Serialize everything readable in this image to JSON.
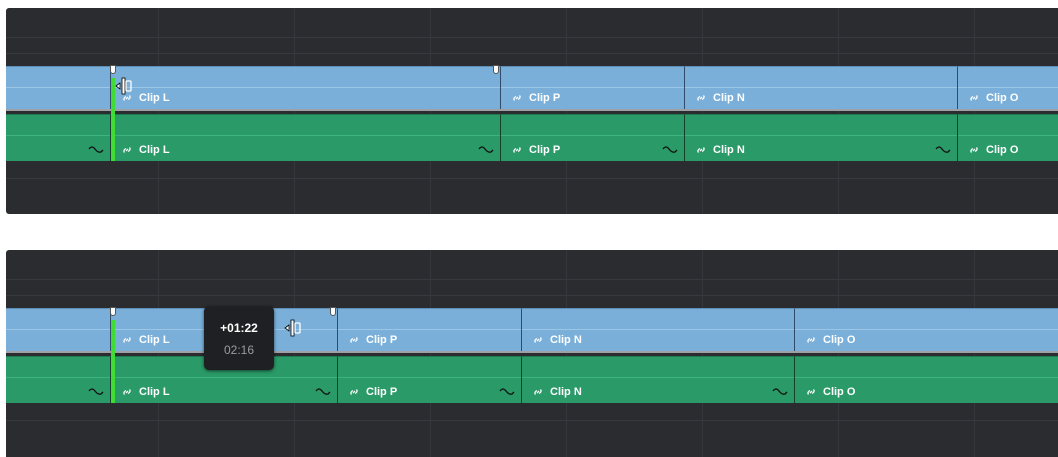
{
  "colors": {
    "panel_bg": "#2b2c30",
    "video_clip": "#79afd9",
    "audio_clip": "#2a9a68",
    "trim_edge": "#3fdd33"
  },
  "icons": [
    "link-icon",
    "waveform-icon",
    "trim-cursor-icon",
    "clip-handle"
  ],
  "top_timeline": {
    "video_clips": [
      {
        "label": ""
      },
      {
        "label": "Clip L"
      },
      {
        "label": "Clip P"
      },
      {
        "label": "Clip N"
      },
      {
        "label": "Clip O"
      }
    ],
    "audio_clips": [
      {
        "label": ""
      },
      {
        "label": "Clip L"
      },
      {
        "label": "Clip P"
      },
      {
        "label": "Clip N"
      },
      {
        "label": "Clip O"
      }
    ]
  },
  "bottom_timeline": {
    "video_clips": [
      {
        "label": ""
      },
      {
        "label": "Clip L"
      },
      {
        "label": "Clip P"
      },
      {
        "label": "Clip N"
      },
      {
        "label": "Clip O"
      }
    ],
    "audio_clips": [
      {
        "label": ""
      },
      {
        "label": "Clip L"
      },
      {
        "label": "Clip P"
      },
      {
        "label": "Clip N"
      },
      {
        "label": "Clip O"
      }
    ],
    "tooltip": {
      "offset": "+01:22",
      "duration": "02:16"
    }
  }
}
